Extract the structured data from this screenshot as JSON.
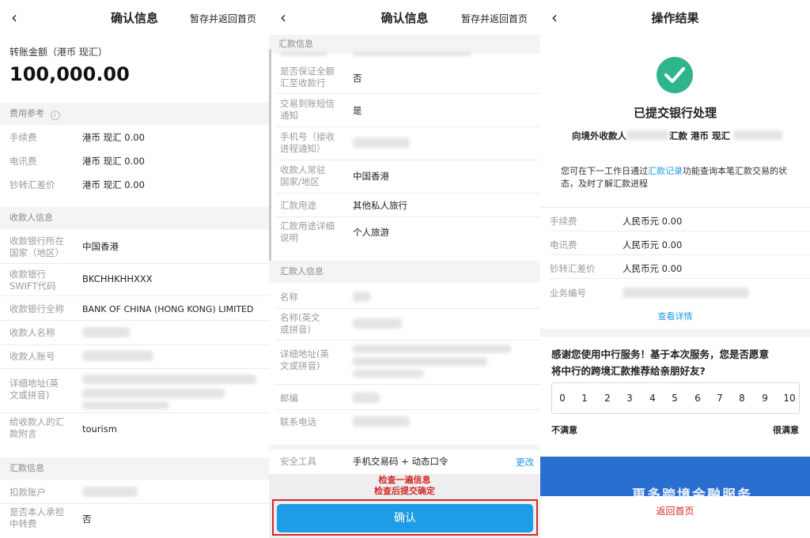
{
  "p1": {
    "title": "确认信息",
    "save": "暂存并返回首页",
    "amount_label": "转账金额（港币 现汇）",
    "amount": "100,000.00",
    "fee_section": "费用参考",
    "fees": [
      {
        "label": "手续费",
        "value": "港币 现汇 0.00"
      },
      {
        "label": "电讯费",
        "value": "港币 现汇 0.00"
      },
      {
        "label": "钞转汇差价",
        "value": "港币 现汇 0.00"
      }
    ],
    "payee_section": "收款人信息",
    "bank_country_label": [
      "收款银行所在",
      "国家（地区）"
    ],
    "bank_country_value": "中国香港",
    "swift_label": [
      "收款银行",
      "SWIFT代码"
    ],
    "swift_value": "BKCHHKHHXXX",
    "bank_name_label": "收款银行全称",
    "bank_name_value": "BANK OF CHINA (HONG KONG) LIMITED",
    "payee_name_label": "收款人名称",
    "payee_acct_label": "收款人账号",
    "address_label": [
      "详细地址(英",
      "文或拼音)"
    ],
    "memo_label": [
      "给收款人的汇",
      "款附言"
    ],
    "memo_value": "tourism",
    "remit_section": "汇款信息",
    "debit_label": "扣款账户",
    "bear_label": [
      "是否本人承担",
      "中转费"
    ],
    "bear_value": "否"
  },
  "p2": {
    "title": "确认信息",
    "save": "暂存并返回首页",
    "remit_section": "汇款信息",
    "guarantee_label": [
      "是否保证全额",
      "汇至收款行"
    ],
    "guarantee_value": "否",
    "sms_label": [
      "交易到账短信",
      "通知"
    ],
    "sms_value": "是",
    "phone_label": [
      "手机号（接收",
      "进程通知）"
    ],
    "residence_label": [
      "收款人常驻",
      "国家/地区"
    ],
    "residence_value": "中国香港",
    "purpose_label": "汇款用途",
    "purpose_value": "其他私人旅行",
    "purpose_detail_label": [
      "汇款用途详细",
      "说明"
    ],
    "purpose_detail_value": "个人旅游",
    "remitter_section": "汇款人信息",
    "name_label": "名称",
    "name_en_label": [
      "名称(英文",
      "或拼音)"
    ],
    "address_label": [
      "详细地址(英",
      "文或拼音)"
    ],
    "zip_label": "邮编",
    "tel_label": "联系电话",
    "security_label": "安全工具",
    "security_value": "手机交易码 + 动态口令",
    "change": "更改",
    "note1": "检查一遍信息",
    "note2": "检查后提交确定",
    "confirm": "确认"
  },
  "p3": {
    "title": "操作结果",
    "status": "已提交银行处理",
    "summary_prefix": "向境外收款人",
    "summary_mid": "汇款 港币 现汇",
    "info_pre": "您可在下一工作日通过",
    "info_link": "汇款记录",
    "info_post": "功能查询本笔汇款交易的状",
    "info_line2": "态，及时了解汇款进程",
    "fees": [
      {
        "label": "手续费",
        "value": "人民币元 0.00"
      },
      {
        "label": "电讯费",
        "value": "人民币元 0.00"
      },
      {
        "label": "钞转汇差价",
        "value": "人民币元 0.00"
      }
    ],
    "biz_no_label": "业务编号",
    "details_link": "查看详情",
    "survey_line1": "感谢您使用中行服务！基于本次服务，您是否愿意",
    "survey_line2": "将中行的跨境汇款推荐给亲朋好友?",
    "scale": [
      "0",
      "1",
      "2",
      "3",
      "4",
      "5",
      "6",
      "7",
      "8",
      "9",
      "10"
    ],
    "low": "不满意",
    "high": "很满意",
    "banner_text": "更多跨境金融服务",
    "home": "返回首页"
  },
  "colors": {
    "accent": "#1f9ce6",
    "success": "#2fb58c",
    "warning": "#d22b2b"
  }
}
